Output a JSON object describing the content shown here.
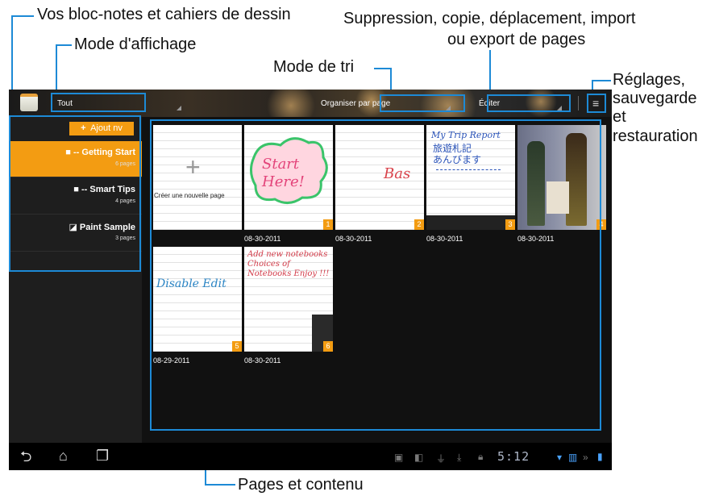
{
  "annotations": {
    "notebooks": "Vos bloc-notes et cahiers de dessin",
    "view_mode": "Mode d'affichage",
    "page_ops_line1": "Suppression, copie, déplacement, import",
    "page_ops_line2": "ou export de pages",
    "sort_mode": "Mode de tri",
    "settings_1": "Réglages,",
    "settings_2": "sauvegarde",
    "settings_3": "et",
    "settings_4": "restauration",
    "pages": "Pages et contenu"
  },
  "topbar": {
    "view_value": "Tout",
    "sort_value": "Organiser par page",
    "edit_value": "Éditer"
  },
  "sidebar": {
    "add_button": "Ajout nv",
    "add_icon": "plus-icon",
    "notebooks": [
      {
        "title": "-- Getting Start",
        "pages": "6 pages",
        "selected": true
      },
      {
        "title": "-- Smart Tips",
        "pages": "4 pages",
        "selected": false
      },
      {
        "title": "Paint Sample",
        "pages": "3 pages",
        "selected": false
      }
    ]
  },
  "grid": {
    "new_page_label": "Créer une nouvelle page",
    "pages": [
      {
        "number": "1",
        "date": "08-30-2011",
        "text": "Start Here!"
      },
      {
        "number": "2",
        "date": "08-30-2011",
        "text": "Bas"
      },
      {
        "number": "3",
        "date": "08-30-2011",
        "text": "My Trip Report"
      },
      {
        "number": "4",
        "date": "08-30-2011",
        "text": ""
      },
      {
        "number": "5",
        "date": "08-29-2011",
        "text": "Disable Edit"
      },
      {
        "number": "6",
        "date": "08-30-2011",
        "text": "Add new notebooks Choices of Notebooks Enjoy !!!"
      }
    ]
  },
  "statusbar": {
    "time": "5:12"
  },
  "colors": {
    "accent": "#f39c12",
    "annotation": "#1d8ad6"
  }
}
